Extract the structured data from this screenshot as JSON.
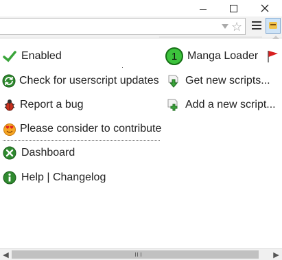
{
  "window": {
    "minimize_symbol": "—",
    "maximize_symbol": "☐",
    "close_symbol": "✕"
  },
  "menu_left": [
    {
      "label": "Enabled",
      "icon": "checkmark-icon"
    },
    {
      "label": "Check for userscript updates",
      "icon": "refresh-icon"
    },
    {
      "label": "Report a bug",
      "icon": "bug-icon"
    },
    {
      "label": "Please consider to contribute",
      "icon": "smiley-heart-icon"
    },
    {
      "label": "Dashboard",
      "icon": "dashboard-icon"
    },
    {
      "label": "Help | Changelog",
      "icon": "info-icon"
    }
  ],
  "menu_right": [
    {
      "label": "Manga Loader",
      "badge": "1",
      "icon": "flag-icon"
    },
    {
      "label": "Get new scripts...",
      "icon": "download-icon"
    },
    {
      "label": "Add a new script...",
      "icon": "add-script-icon"
    }
  ],
  "colors": {
    "check": "#3aa43a",
    "badge_green": "#3cc23c",
    "flag_red": "#d82020"
  }
}
